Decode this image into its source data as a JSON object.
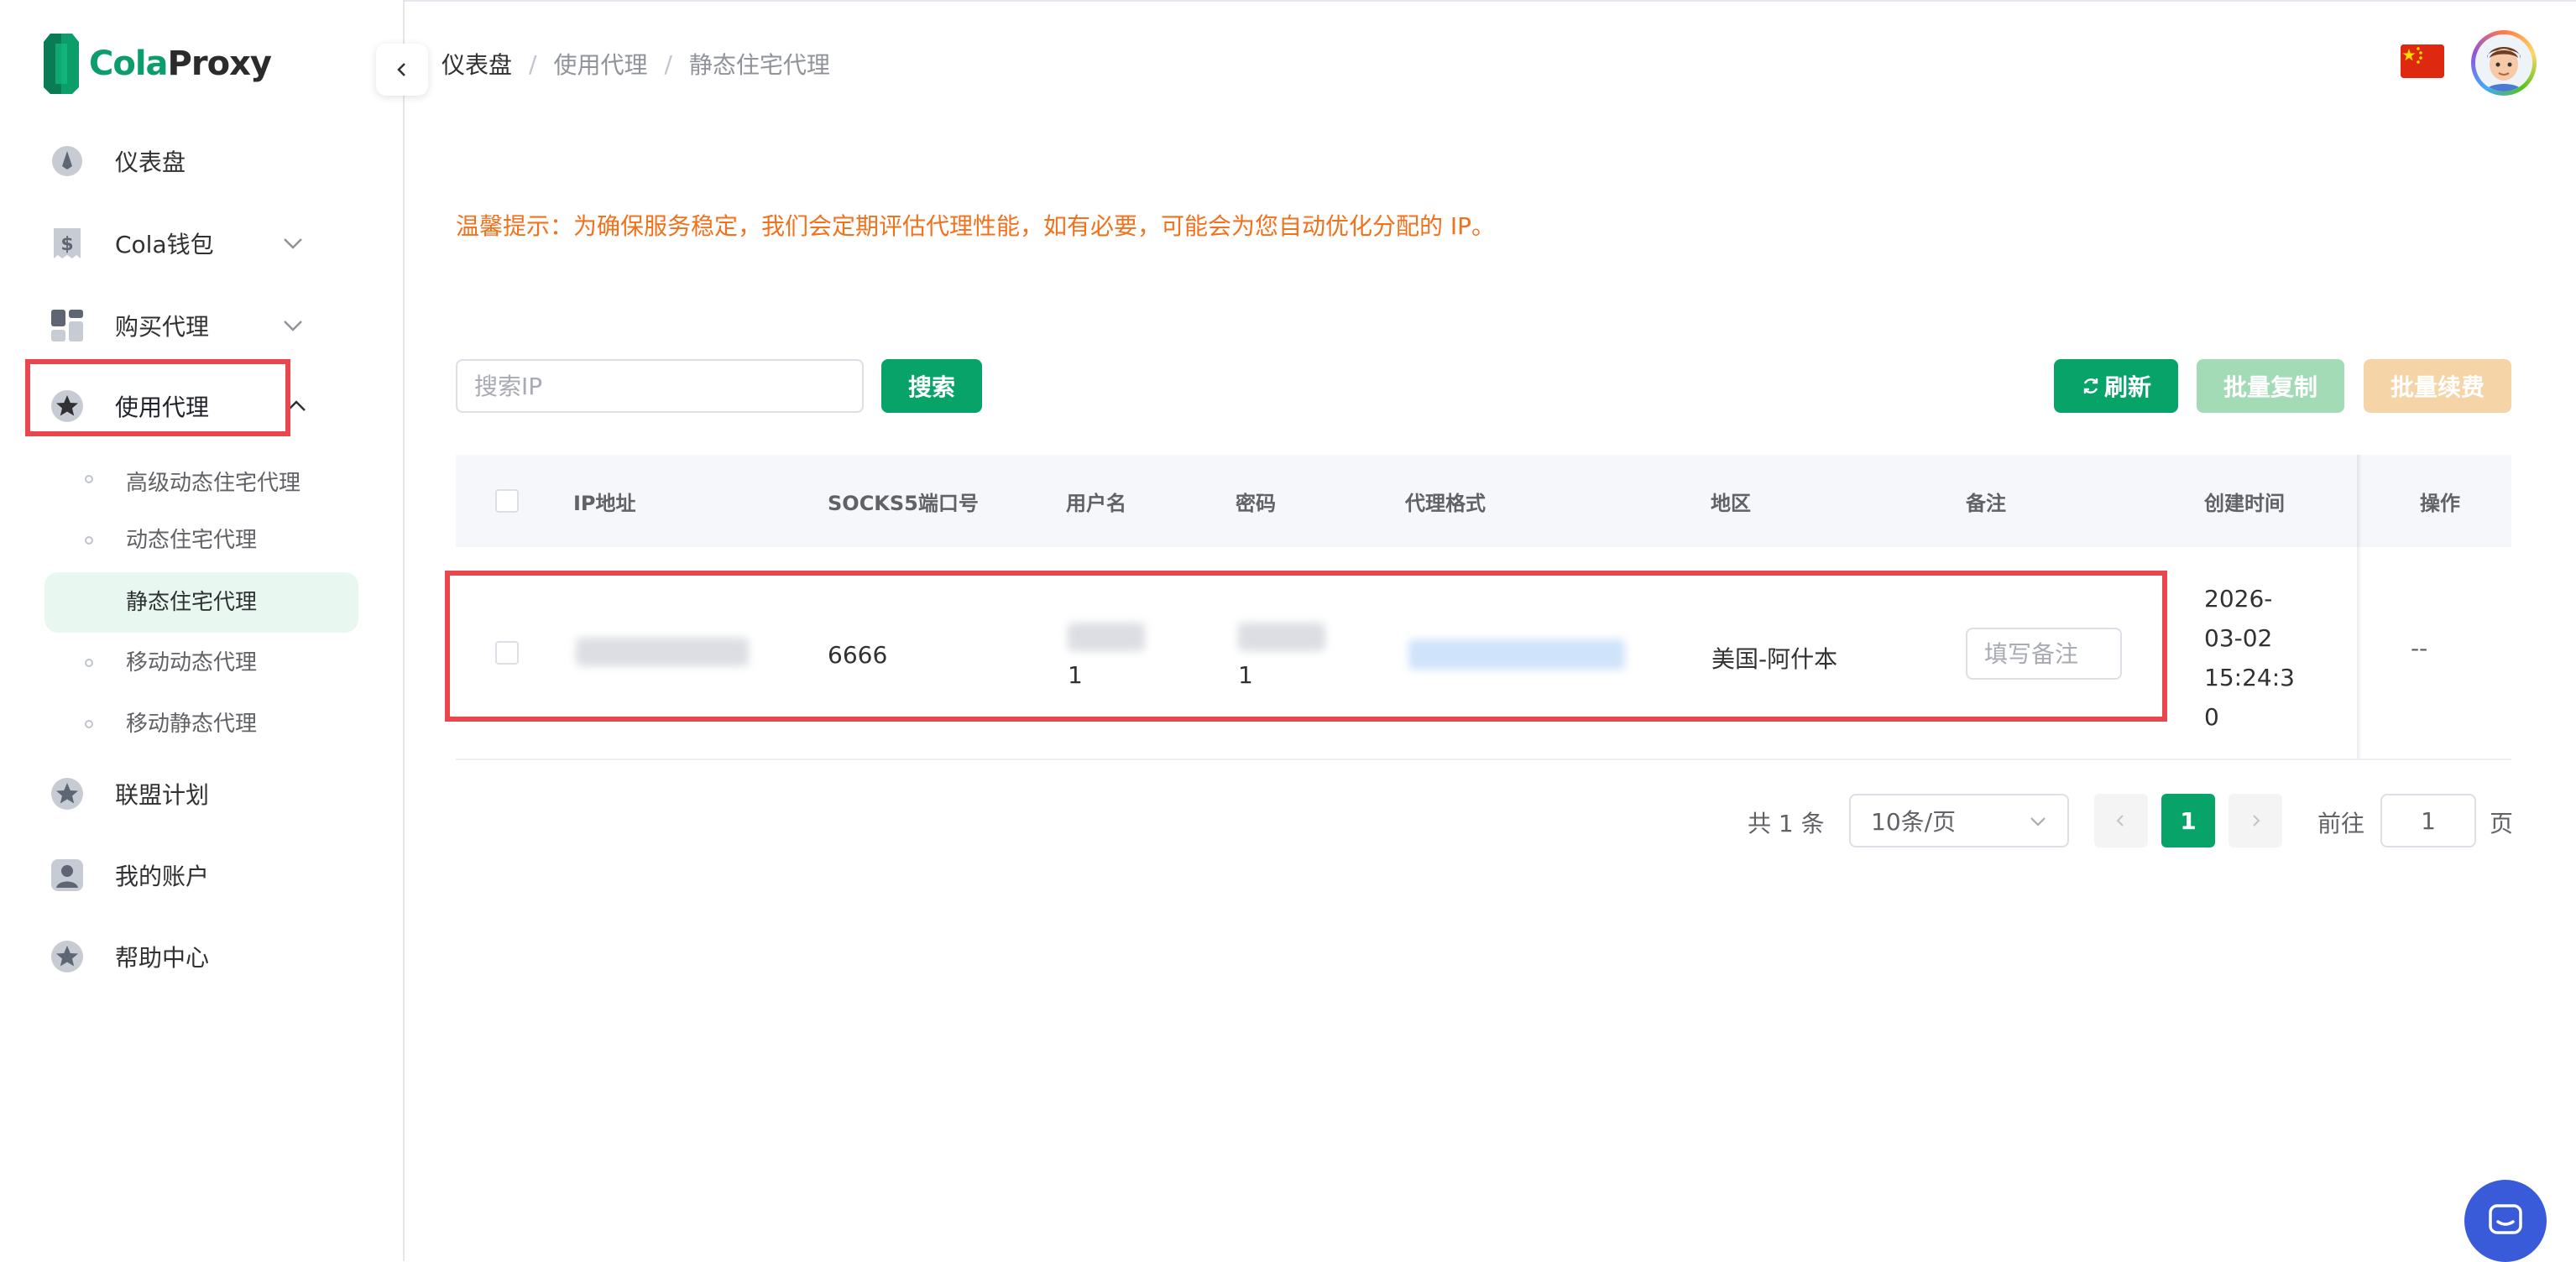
{
  "brand": {
    "part1": "Cola",
    "part2": "Proxy"
  },
  "sidebar": {
    "items": [
      {
        "label": "仪表盘"
      },
      {
        "label": "Cola钱包"
      },
      {
        "label": "购买代理"
      },
      {
        "label": "使用代理"
      },
      {
        "label": "联盟计划"
      },
      {
        "label": "我的账户"
      },
      {
        "label": "帮助中心"
      }
    ],
    "sub_items": [
      {
        "label": "高级动态住宅代理"
      },
      {
        "label": "动态住宅代理"
      },
      {
        "label": "静态住宅代理"
      },
      {
        "label": "移动动态代理"
      },
      {
        "label": "移动静态代理"
      }
    ]
  },
  "breadcrumb": [
    "仪表盘",
    "使用代理",
    "静态住宅代理"
  ],
  "breadcrumb_separator": "/",
  "notice": "温馨提示：为确保服务稳定，我们会定期评估代理性能，如有必要，可能会为您自动优化分配的 IP。",
  "toolbar": {
    "search_placeholder": "搜索IP",
    "search_label": "搜索",
    "refresh_label": "刷新",
    "batch_copy_label": "批量复制",
    "batch_renew_label": "批量续费"
  },
  "table": {
    "columns": [
      "IP地址",
      "SOCKS5端口号",
      "用户名",
      "密码",
      "代理格式",
      "地区",
      "备注",
      "创建时间",
      "操作"
    ],
    "rows": [
      {
        "port": "6666",
        "username_tail": "1",
        "password_tail": "1",
        "region": "美国-阿什本",
        "remark_placeholder": "填写备注",
        "created_lines": [
          "2026-",
          "03-02",
          "15:24:3",
          "0"
        ],
        "action": "--"
      }
    ]
  },
  "pagination": {
    "total": "共 1 条",
    "page_size": "10条/页",
    "current_page": "1",
    "goto_label": "前往",
    "goto_value": "1",
    "goto_suffix": "页"
  },
  "colors": {
    "primary": "#07a368",
    "notice": "#f2711c",
    "highlight": "#e8484d",
    "chat": "#3a5bd9"
  },
  "icons": {
    "dashboard": "gauge-icon",
    "wallet": "dollar-receipt-icon",
    "buy": "grid-icon",
    "use": "star-icon",
    "collapse": "chevron-left-icon",
    "flag": "china-flag-icon",
    "refresh": "refresh-icon",
    "chat": "chat-icon"
  }
}
